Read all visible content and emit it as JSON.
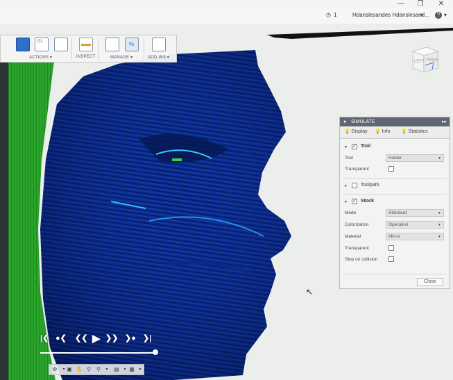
{
  "window": {
    "minimize": "—",
    "restore": "❐",
    "close": "✕"
  },
  "userbar": {
    "jobs_count": "1",
    "user_name": "Hdanslesandes Hdanslesand...",
    "help": "?"
  },
  "toolbar": {
    "groups": [
      {
        "label": "ACTIONS ▾"
      },
      {
        "label": "INSPECT"
      },
      {
        "label": "MANAGE ▾"
      },
      {
        "label": "ADD-INS ▾"
      }
    ]
  },
  "viewcube": {
    "left": "LEFT",
    "front": "FRON"
  },
  "panel": {
    "title": "SIMULATE",
    "tabs": [
      "Display",
      "Info",
      "Statistics"
    ],
    "tool_section": {
      "title": "Tool",
      "checked": true,
      "tool_label": "Tool",
      "tool_value": "Holder",
      "transparent_label": "Transparent"
    },
    "toolpath_section": {
      "title": "Toolpath",
      "checked": false
    },
    "stock_section": {
      "title": "Stock",
      "checked": true,
      "mode_label": "Mode",
      "mode_value": "Standard",
      "colorization_label": "Colorization",
      "colorization_value": "Operation",
      "material_label": "Material",
      "material_value": "Mirror",
      "transparent_label": "Transparent",
      "stop_label": "Stop on collision"
    },
    "close_label": "Close"
  },
  "colors": {
    "stock_blue": "#0a2a8a",
    "stock_green": "#2aa428",
    "panel_header": "#5e6673"
  }
}
